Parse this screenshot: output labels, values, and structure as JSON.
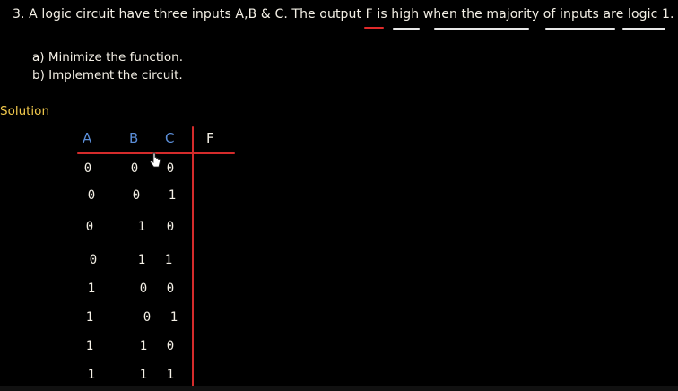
{
  "question": {
    "text": "3.  A logic circuit have three inputs A,B & C. The output F is high when the majority of inputs are logic 1.",
    "part_a": "a) Minimize the function.",
    "part_b": "b) Implement the circuit."
  },
  "solution_label": "Solution",
  "truth_table": {
    "headers": [
      "A",
      "B",
      "C",
      "F"
    ],
    "rows": [
      [
        "0",
        "0",
        "0",
        ""
      ],
      [
        "0",
        "0",
        "1",
        ""
      ],
      [
        "0",
        "1",
        "0",
        ""
      ],
      [
        "0",
        "1",
        "1",
        ""
      ],
      [
        "1",
        "0",
        "0",
        ""
      ],
      [
        "1",
        "0",
        "1",
        ""
      ],
      [
        "1",
        "1",
        "0",
        ""
      ],
      [
        "1",
        "1",
        "1",
        ""
      ]
    ]
  },
  "colors": {
    "background": "#000000",
    "text": "#f4f0e6",
    "header_blue": "#5b8ed8",
    "table_lines": "#d42b2b",
    "solution": "#f2c94c",
    "underline_red": "#e02a2a"
  },
  "icons": {
    "cursor": "hand-pointer-icon"
  }
}
